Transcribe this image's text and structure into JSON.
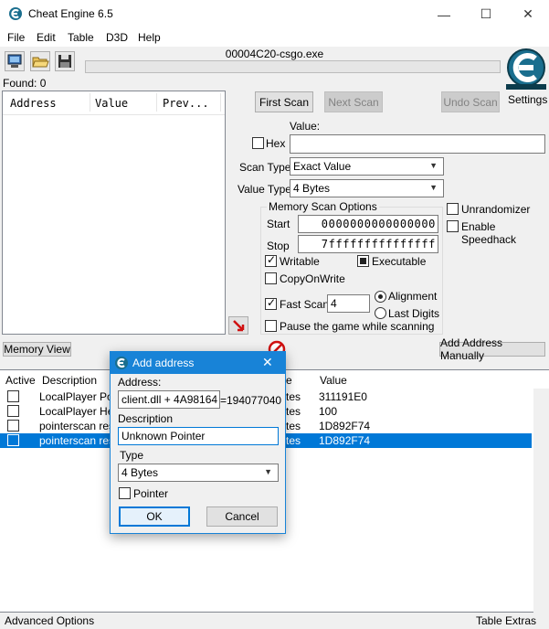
{
  "window": {
    "title": "Cheat Engine 6.5",
    "minimize": "—",
    "maximize": "☐",
    "close": "✕"
  },
  "menu": {
    "file": "File",
    "edit": "Edit",
    "table": "Table",
    "d3d": "D3D",
    "help": "Help"
  },
  "process": {
    "name": "00004C20-csgo.exe",
    "progress": 0
  },
  "found": "Found: 0",
  "results": {
    "columns": [
      "Address",
      "Value",
      "Prev..."
    ]
  },
  "scan": {
    "first_scan": "First Scan",
    "next_scan": "Next Scan",
    "undo_scan": "Undo Scan",
    "settings": "Settings",
    "value_label": "Value:",
    "hex_label": "Hex",
    "value": "",
    "scan_type_label": "Scan Type",
    "scan_type_value": "Exact Value",
    "value_type_label": "Value Type",
    "value_type_value": "4 Bytes"
  },
  "memory_options": {
    "title": "Memory Scan Options",
    "start_label": "Start",
    "start_value": "0000000000000000",
    "stop_label": "Stop",
    "stop_value": "7fffffffffffffff",
    "writable": "Writable",
    "executable": "Executable",
    "copyonwrite": "CopyOnWrite",
    "fast_scan": "Fast Scan",
    "fast_scan_value": "4",
    "alignment": "Alignment",
    "last_digits": "Last Digits",
    "pause": "Pause the game while scanning",
    "unrandomizer": "Unrandomizer",
    "speedhack": "Enable Speedhack"
  },
  "bottom_buttons": {
    "memory_view": "Memory View",
    "add_address_manually": "Add Address Manually"
  },
  "address_table": {
    "headers": {
      "active": "Active",
      "description": "Description",
      "type": "e",
      "value": "Value"
    },
    "rows": [
      {
        "description": "LocalPlayer Poin",
        "type": "tes",
        "value": "311191E0",
        "selected": false
      },
      {
        "description": "LocalPlayer Hea",
        "type": "tes",
        "value": "100",
        "selected": false
      },
      {
        "description": "pointerscan resu",
        "type": "tes",
        "value": "1D892F74",
        "selected": false
      },
      {
        "description": "pointerscan resu",
        "type": "tes",
        "value": "1D892F74",
        "selected": true
      }
    ]
  },
  "statusbar": {
    "advanced": "Advanced Options",
    "extras": "Table Extras"
  },
  "dialog": {
    "title": "Add address",
    "close": "✕",
    "address_label": "Address:",
    "address_value": "client.dll + 4A98164",
    "address_result": "=194077040",
    "description_label": "Description",
    "description_value": "Unknown Pointer",
    "type_label": "Type",
    "type_value": "4 Bytes",
    "pointer_label": "Pointer",
    "ok": "OK",
    "cancel": "Cancel"
  },
  "colors": {
    "accent": "#0078d7",
    "dialog_title": "#1883d7",
    "logo": "#1a6e8e"
  }
}
